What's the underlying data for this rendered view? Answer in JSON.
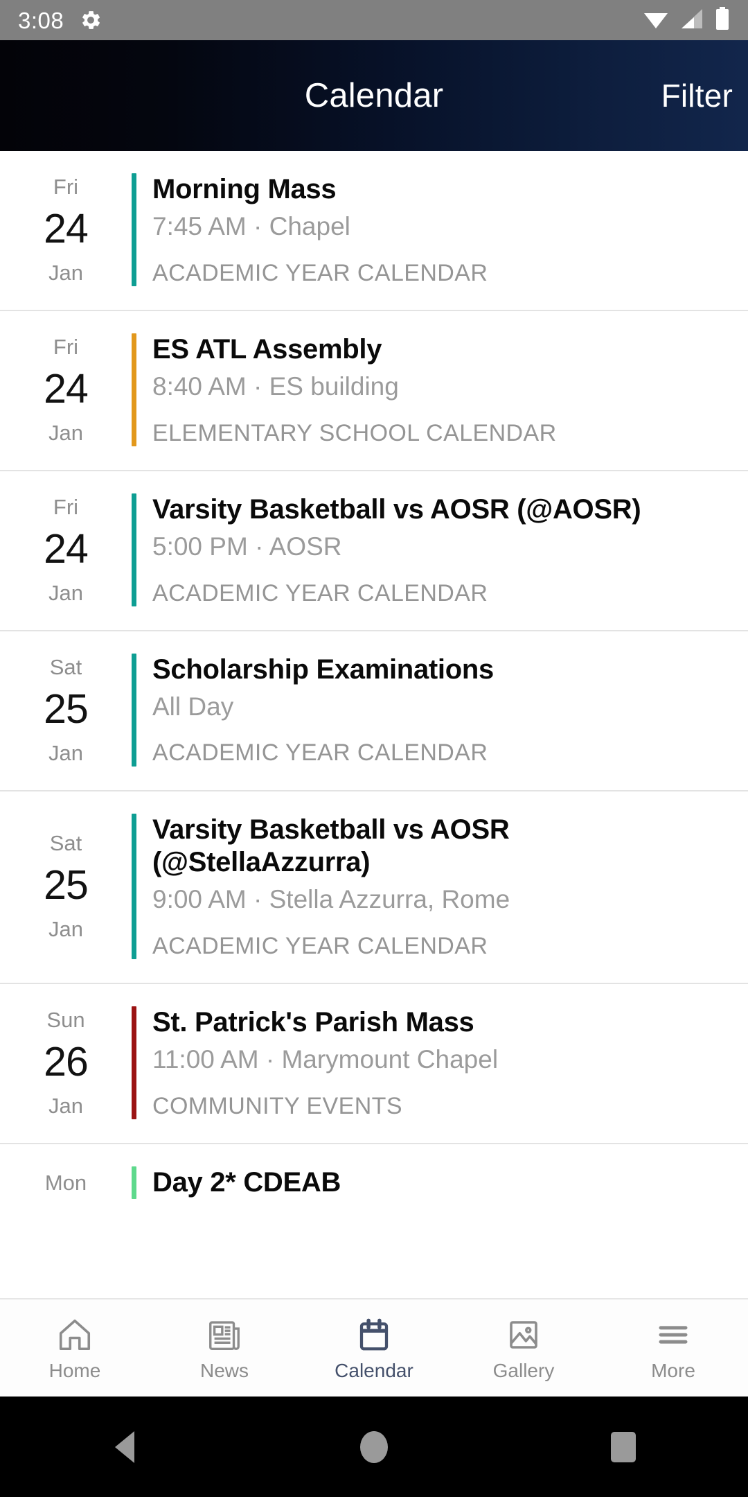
{
  "status_bar": {
    "time": "3:08",
    "icons": [
      "gear-icon",
      "wifi-icon",
      "cell-signal-icon",
      "battery-icon"
    ]
  },
  "header": {
    "title": "Calendar",
    "action_label": "Filter",
    "gradient_from": "#030308",
    "gradient_to": "#12264c"
  },
  "events": [
    {
      "dow": "Fri",
      "day": "24",
      "month": "Jan",
      "title": "Morning Mass",
      "subtitle": "7:45 AM · Chapel",
      "category": "ACADEMIC YEAR CALENDAR",
      "accent_color": "#0e9e93"
    },
    {
      "dow": "Fri",
      "day": "24",
      "month": "Jan",
      "title": "ES ATL Assembly",
      "subtitle": "8:40 AM · ES building",
      "category": "ELEMENTARY SCHOOL CALENDAR",
      "accent_color": "#e2981c"
    },
    {
      "dow": "Fri",
      "day": "24",
      "month": "Jan",
      "title": "Varsity Basketball vs AOSR (@AOSR)",
      "subtitle": "5:00 PM · AOSR",
      "category": "ACADEMIC YEAR CALENDAR",
      "accent_color": "#0e9e93"
    },
    {
      "dow": "Sat",
      "day": "25",
      "month": "Jan",
      "title": "Scholarship Examinations",
      "subtitle": "All Day",
      "category": "ACADEMIC YEAR CALENDAR",
      "accent_color": "#0e9e93"
    },
    {
      "dow": "Sat",
      "day": "25",
      "month": "Jan",
      "title": "Varsity Basketball vs AOSR (@StellaAzzurra)",
      "subtitle": "9:00 AM · Stella Azzurra, Rome",
      "category": "ACADEMIC YEAR CALENDAR",
      "accent_color": "#0e9e93"
    },
    {
      "dow": "Sun",
      "day": "26",
      "month": "Jan",
      "title": "St. Patrick's Parish Mass",
      "subtitle": "11:00 AM · Marymount Chapel",
      "category": "COMMUNITY EVENTS",
      "accent_color": "#9b1313"
    },
    {
      "dow": "Mon",
      "day": "",
      "month": "",
      "title": "Day 2* CDEAB",
      "subtitle": "",
      "category": "",
      "accent_color": "#5ed98c"
    }
  ],
  "bottom_nav": {
    "active_color": "#44506b",
    "inactive_color": "#8c8c8c",
    "items": [
      {
        "label": "Home",
        "icon": "home-icon"
      },
      {
        "label": "News",
        "icon": "newspaper-icon"
      },
      {
        "label": "Calendar",
        "icon": "calendar-icon"
      },
      {
        "label": "Gallery",
        "icon": "image-icon"
      },
      {
        "label": "More",
        "icon": "hamburger-menu-icon"
      }
    ]
  },
  "system_nav": {
    "back": "back-triangle",
    "home": "home-circle",
    "recents": "recents-square"
  }
}
